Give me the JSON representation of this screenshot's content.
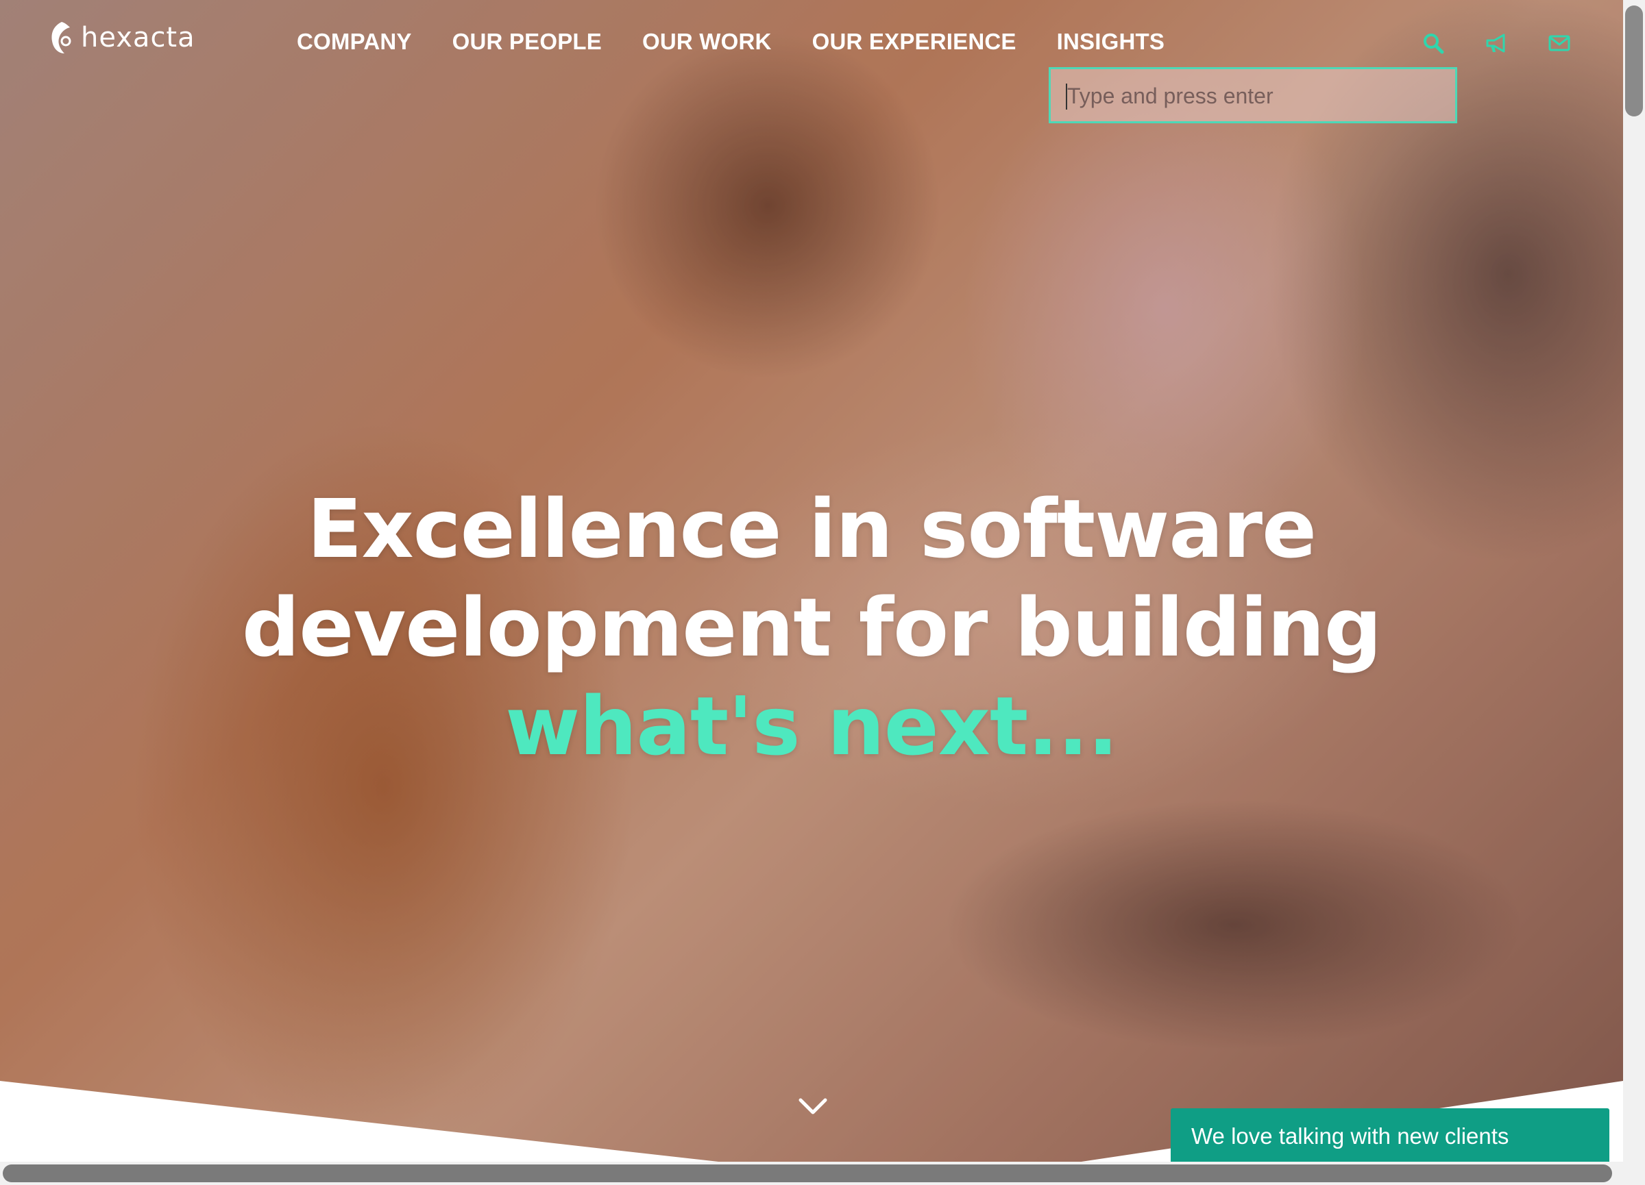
{
  "brand": {
    "name": "hexacta"
  },
  "nav": {
    "items": [
      "COMPANY",
      "OUR PEOPLE",
      "OUR WORK",
      "OUR EXPERIENCE",
      "INSIGHTS"
    ],
    "icons": [
      "search-icon",
      "megaphone-icon",
      "envelope-icon"
    ]
  },
  "search": {
    "placeholder": "Type and press enter",
    "value": ""
  },
  "hero": {
    "line1": "Excellence in software",
    "line2": "development for building",
    "accent": "what's next..."
  },
  "chat": {
    "label": "We love talking with new clients"
  },
  "colors": {
    "accent": "#4ee8bf",
    "chat_bg": "#0f9e85",
    "search_border": "#4dd9b7"
  }
}
